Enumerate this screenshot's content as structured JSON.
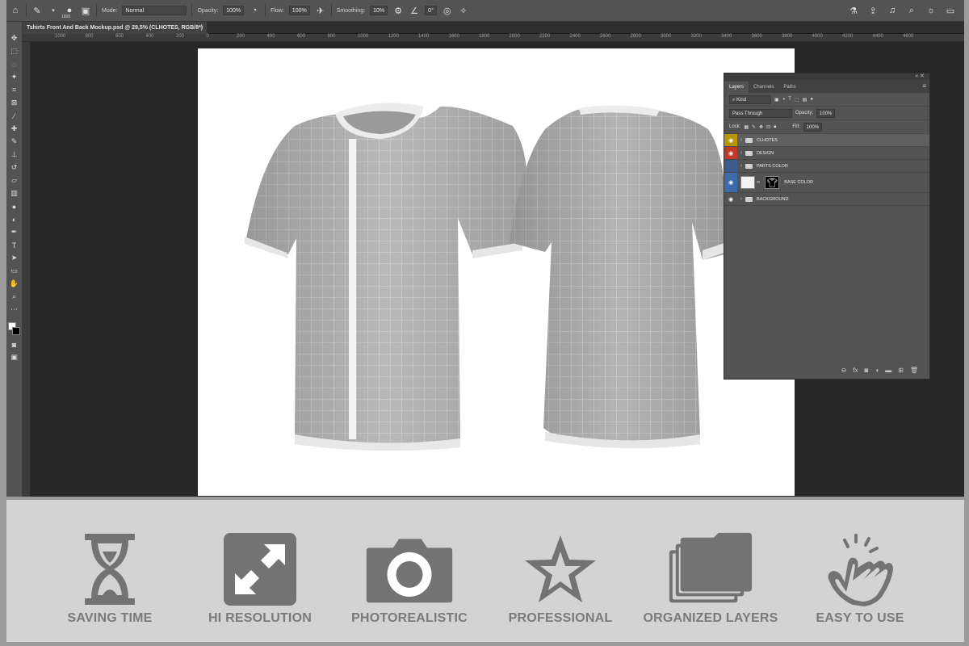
{
  "app": {
    "options_bar": {
      "brush_size": "1805",
      "mode_label": "Mode:",
      "mode_value": "Normal",
      "opacity_label": "Opacity:",
      "opacity_value": "100%",
      "flow_label": "Flow:",
      "flow_value": "100%",
      "smoothing_label": "Smoothing:",
      "smoothing_value": "10%",
      "angle_value": "0°"
    },
    "document_tab": {
      "title": "Tshirts Front And Back Mockup.psd @ 29,5% (CLHOTES, RGB/8*)",
      "close": "×"
    },
    "ruler_ticks": [
      "1000",
      "800",
      "600",
      "400",
      "200",
      "0",
      "200",
      "400",
      "600",
      "800",
      "1000",
      "1200",
      "1400",
      "1600",
      "1800",
      "2000",
      "2200",
      "2400",
      "2600",
      "2800",
      "3000",
      "3200",
      "3400",
      "3600",
      "3800",
      "4000",
      "4200",
      "4400",
      "4600"
    ],
    "layers_panel": {
      "tabs": [
        "Layers",
        "Channels",
        "Paths"
      ],
      "filter_label": "Kind",
      "blend_mode": "Pass Through",
      "opacity_label": "Opacity:",
      "opacity_value": "100%",
      "lock_label": "Lock:",
      "fill_label": "Fill:",
      "fill_value": "100%",
      "layers": [
        {
          "name": "CLHOTES",
          "eye_color": "#b8960c",
          "selected": true
        },
        {
          "name": "DESIGN",
          "eye_color": "#c0392b",
          "selected": false
        },
        {
          "name": "PARTS COLOR",
          "eye_color": "#3d5a8c",
          "selected": false
        },
        {
          "name": "BASE COLOR",
          "eye_color": "#3d6aa8",
          "selected": false
        },
        {
          "name": "BACKGROUND",
          "eye_color": "",
          "selected": false
        }
      ]
    }
  },
  "features": [
    {
      "label": "SAVING TIME",
      "icon": "hourglass-icon"
    },
    {
      "label": "HI RESOLUTION",
      "icon": "expand-arrows-icon"
    },
    {
      "label": "PHOTOREALISTIC",
      "icon": "camera-icon"
    },
    {
      "label": "PROFESSIONAL",
      "icon": "star-icon"
    },
    {
      "label": "ORGANIZED LAYERS",
      "icon": "stacked-layers-icon"
    },
    {
      "label": "EASY TO USE",
      "icon": "pointing-hand-icon"
    }
  ],
  "colors": {
    "strip_bg": "#d3d3d3",
    "icon_gray": "#737373",
    "label_gray": "#7a7a7a"
  }
}
